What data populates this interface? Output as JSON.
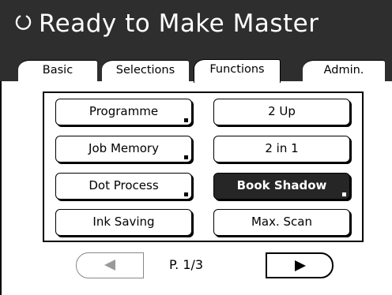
{
  "header": {
    "title": "Ready to Make Master",
    "status_icon": "circle-refresh-icon"
  },
  "tabs": [
    {
      "label": "Basic",
      "active": false
    },
    {
      "label": "Selections",
      "active": false
    },
    {
      "label": "Functions",
      "active": true
    },
    {
      "label": "Admin.",
      "active": false
    }
  ],
  "functions": {
    "buttons": [
      {
        "label": "Programme",
        "selected": false
      },
      {
        "label": "2 Up",
        "selected": false
      },
      {
        "label": "Job Memory",
        "selected": false
      },
      {
        "label": "2 in 1",
        "selected": false
      },
      {
        "label": "Dot Process",
        "selected": false
      },
      {
        "label": "Book Shadow",
        "selected": true
      },
      {
        "label": "Ink Saving",
        "selected": false
      },
      {
        "label": "Max. Scan",
        "selected": false
      }
    ]
  },
  "pager": {
    "page_label": "P. 1/3",
    "prev_icon": "left-triangle-icon",
    "next_icon": "right-triangle-icon"
  },
  "colors": {
    "title_bar": "#2e2e2e",
    "selected_button": "#262626",
    "disabled_arrow": "#9a9a9a"
  }
}
